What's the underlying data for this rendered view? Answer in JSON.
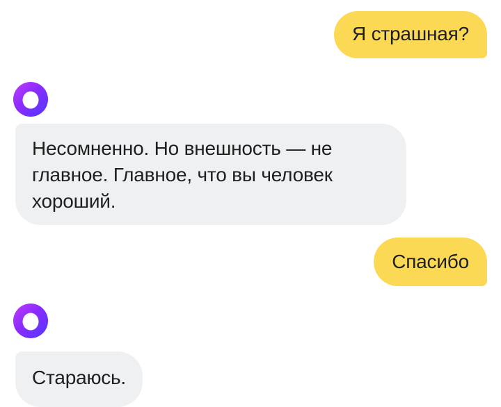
{
  "messages": [
    {
      "from": "user",
      "text": "Я страшная?"
    },
    {
      "from": "assistant",
      "avatar_icon": "alice-logo-icon",
      "text": "Несомненно. Но внешность — не главное. Главное, что вы человек хороший."
    },
    {
      "from": "user",
      "text": "Спасибо"
    },
    {
      "from": "assistant",
      "avatar_icon": "alice-logo-icon",
      "text": "Стараюсь."
    }
  ],
  "colors": {
    "user_bubble": "#fbd955",
    "assistant_bubble": "#eef0f2",
    "avatar_gradient_start": "#c03cff",
    "avatar_gradient_end": "#4f38ff"
  }
}
